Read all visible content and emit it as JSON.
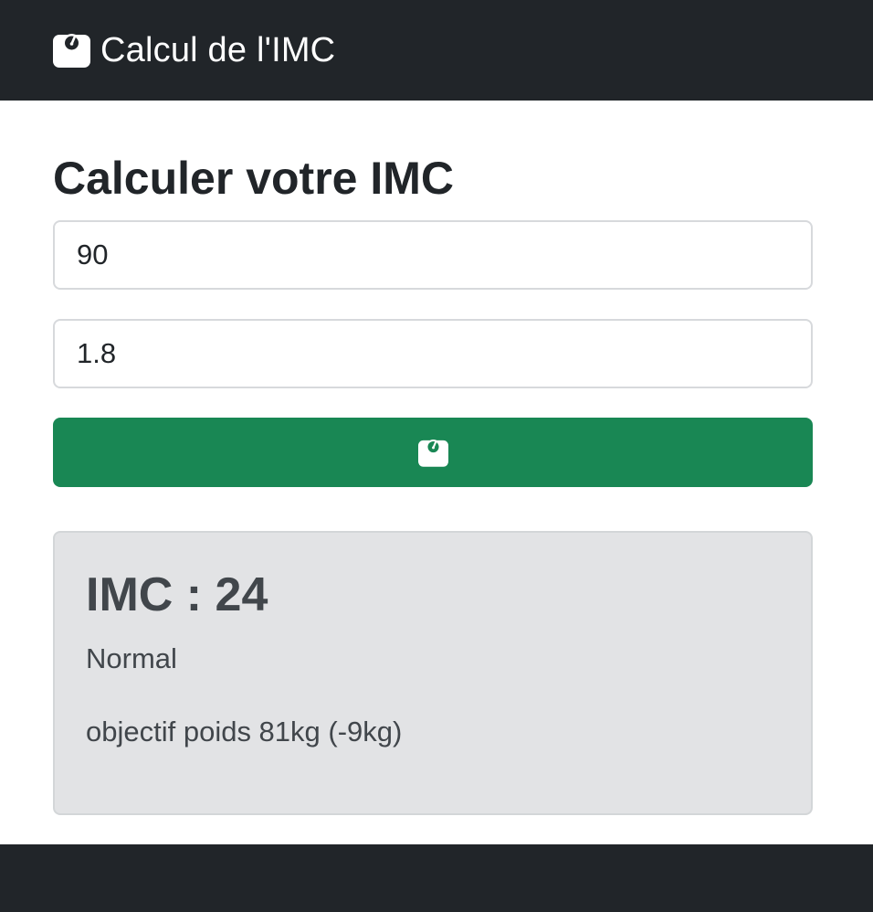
{
  "navbar": {
    "brand_icon": "weight-scale-icon",
    "brand_text": "Calcul de l'IMC"
  },
  "main": {
    "title": "Calculer votre IMC",
    "weight_input": {
      "value": "90"
    },
    "height_input": {
      "value": "1.8"
    },
    "calculate_button": {
      "icon": "weight-scale-icon",
      "color": "#198754"
    }
  },
  "result": {
    "title": "IMC : 24",
    "category": "Normal",
    "goal": "objectif poids 81kg (-9kg)"
  },
  "colors": {
    "navbar_bg": "#212529",
    "footer_bg": "#212529",
    "accent": "#198754",
    "result_bg": "#e2e3e5"
  }
}
